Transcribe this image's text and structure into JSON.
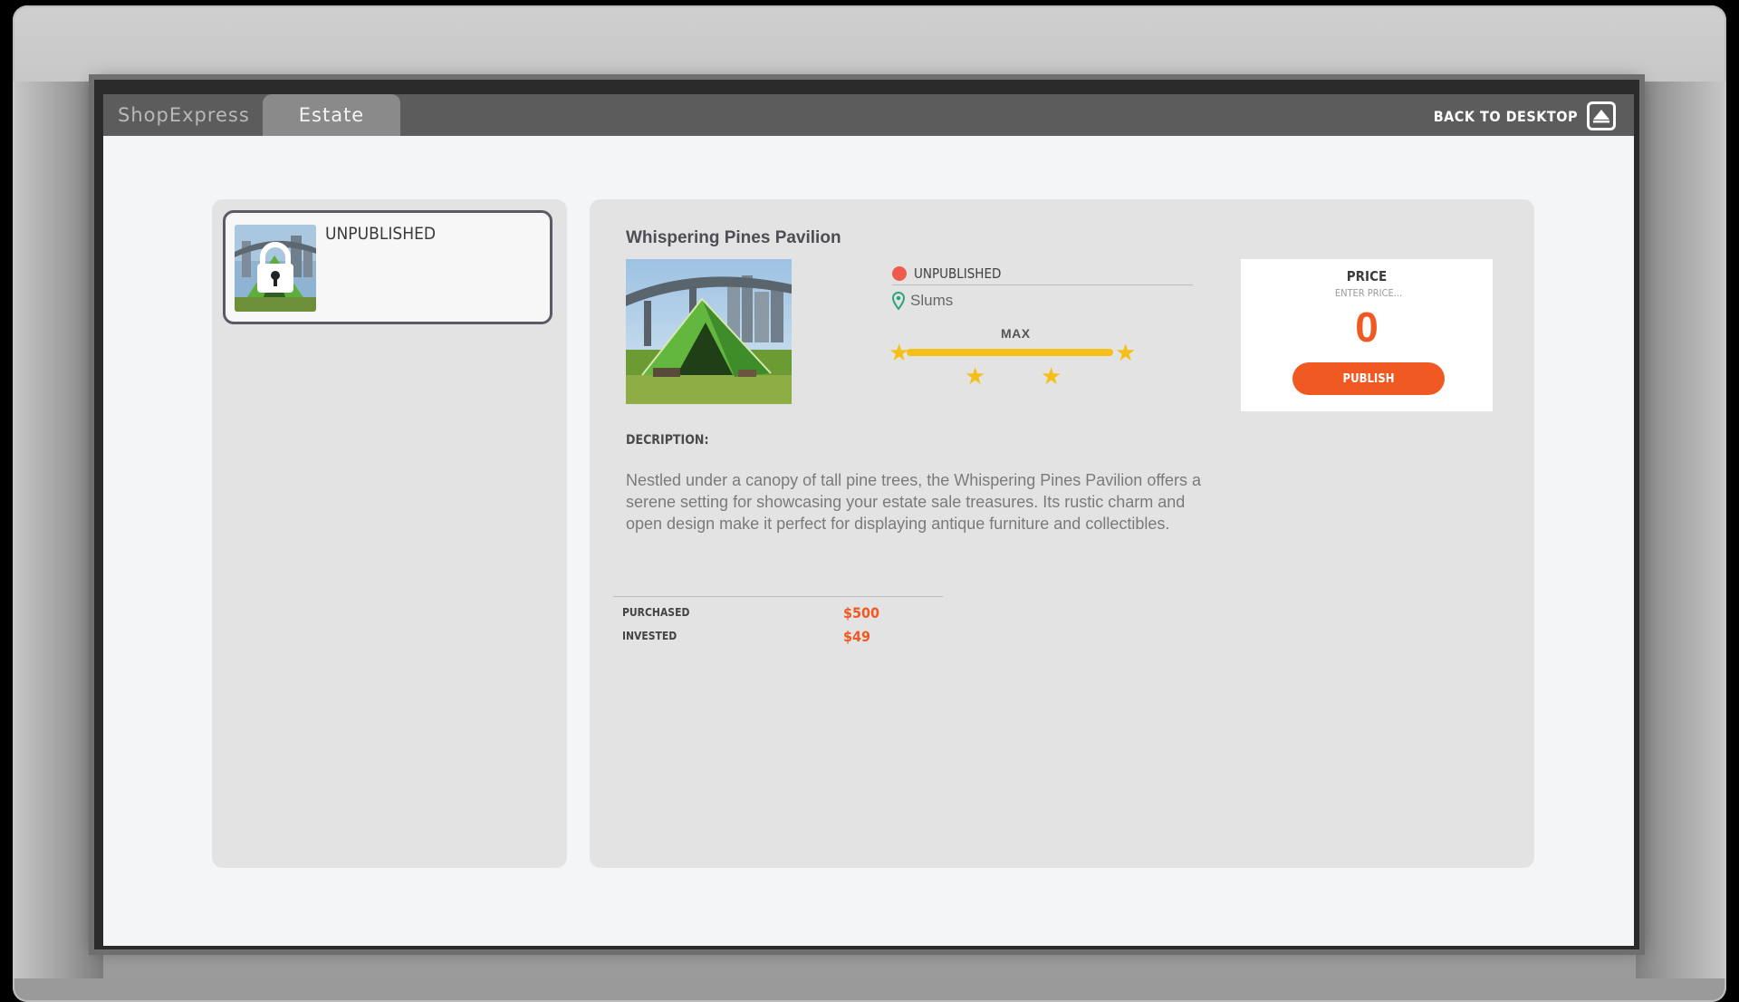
{
  "tabs": [
    {
      "label": "ShopExpress"
    },
    {
      "label": "Estate"
    }
  ],
  "header": {
    "back_label": "BACK TO DESKTOP",
    "back_icon": "eject-icon"
  },
  "listings": [
    {
      "status": "UNPUBLISHED",
      "thumb_icon": "lock-icon"
    }
  ],
  "property": {
    "title": "Whispering Pines Pavilion",
    "status": "UNPUBLISHED",
    "location": "Slums",
    "rating_label": "MAX",
    "rating_stars": 4,
    "description_label": "DECRIPTION:",
    "description": "Nestled under a canopy of tall pine trees, the Whispering Pines Pavilion offers a serene setting for showcasing your estate sale treasures. Its rustic charm and open design make it perfect for displaying antique furniture and collectibles.",
    "stats": [
      {
        "label": "PURCHASED",
        "value": "$500"
      },
      {
        "label": "INVESTED",
        "value": "$49"
      }
    ]
  },
  "price": {
    "label": "PRICE",
    "placeholder": "ENTER PRICE...",
    "value": "0",
    "publish_label": "PUBLISH"
  },
  "colors": {
    "accent": "#f05a22",
    "star": "#f4c018",
    "status_dot": "#ef5a4f",
    "topbar": "#5c5c5c"
  }
}
